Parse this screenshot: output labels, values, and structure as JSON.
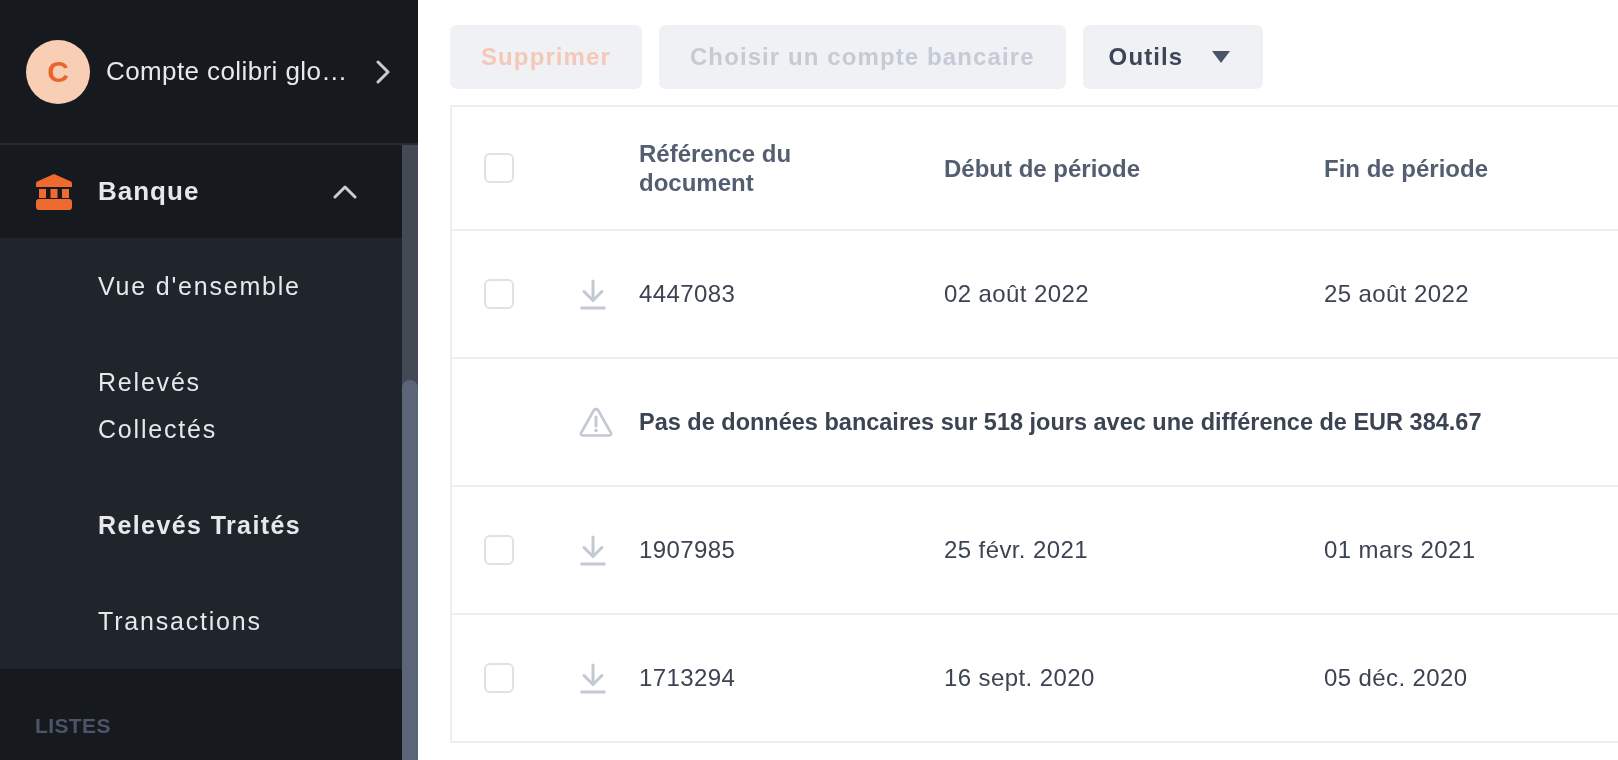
{
  "sidebar": {
    "account": {
      "initial": "C",
      "name": "Compte colibri glo…"
    },
    "nav": [
      {
        "kind": "group",
        "label": "Banque",
        "expanded": true,
        "children": [
          {
            "label": "Vue d'ensemble",
            "selected": false
          },
          {
            "label": "Relevés\nCollectés",
            "selected": false
          },
          {
            "label": "Relevés Traités",
            "selected": true
          },
          {
            "label": "Transactions",
            "selected": false
          }
        ]
      },
      {
        "kind": "heading",
        "label": "LISTES"
      }
    ]
  },
  "toolbar": {
    "buttons": [
      {
        "kind": "danger",
        "label": "Supprimer",
        "disabled": true
      },
      {
        "kind": "plain",
        "label": "Choisir un compte bancaire",
        "disabled": true
      },
      {
        "kind": "menu",
        "label": "Outils",
        "disabled": false
      }
    ]
  },
  "table": {
    "select_all": {
      "checked": false
    },
    "columns": [
      {
        "label": "Référence du document"
      },
      {
        "label": "Début de période"
      },
      {
        "label": "Fin de période"
      }
    ],
    "rows": [
      {
        "kind": "statement",
        "checked": false,
        "reference": "4447083",
        "start": "02 août 2022",
        "end": "25 août 2022"
      },
      {
        "kind": "warning",
        "message": "Pas de données bancaires sur 518 jours avec une différence de EUR 384.67"
      },
      {
        "kind": "statement",
        "checked": false,
        "reference": "1907985",
        "start": "25 févr. 2021",
        "end": "01 mars 2021"
      },
      {
        "kind": "statement",
        "checked": false,
        "reference": "1713294",
        "start": "16 sept. 2020",
        "end": "05 déc. 2020"
      }
    ]
  }
}
